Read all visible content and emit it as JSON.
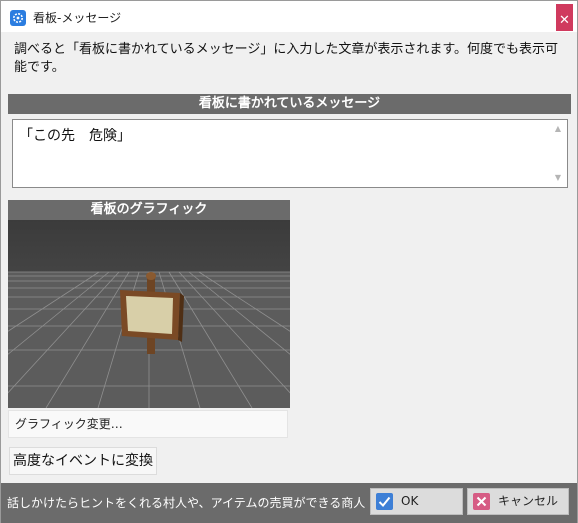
{
  "window": {
    "title": "看板-メッセージ"
  },
  "description": "調べると「看板に書かれているメッセージ」に入力した文章が表示されます。何度でも表示可能です。",
  "message_section": {
    "header": "看板に書かれているメッセージ",
    "text": "「この先　危険」"
  },
  "graphic_section": {
    "header": "看板のグラフィック",
    "change_label": "グラフィック変更…"
  },
  "advanced_button": "高度なイベントに変換",
  "footer": {
    "hint": "話しかけたらヒントをくれる村人や、アイテムの売買ができる商人、お金",
    "ok_label": "OK",
    "cancel_label": "キャンセル"
  },
  "icons": {
    "app": "gear-icon",
    "close": "close-icon",
    "ok": "check-icon",
    "cancel": "cross-icon"
  },
  "colors": {
    "header_bg": "#6b6b6b",
    "close_bg": "#d03a5e",
    "ok_icon": "#3d7fd6",
    "cancel_icon": "#d65c84"
  }
}
